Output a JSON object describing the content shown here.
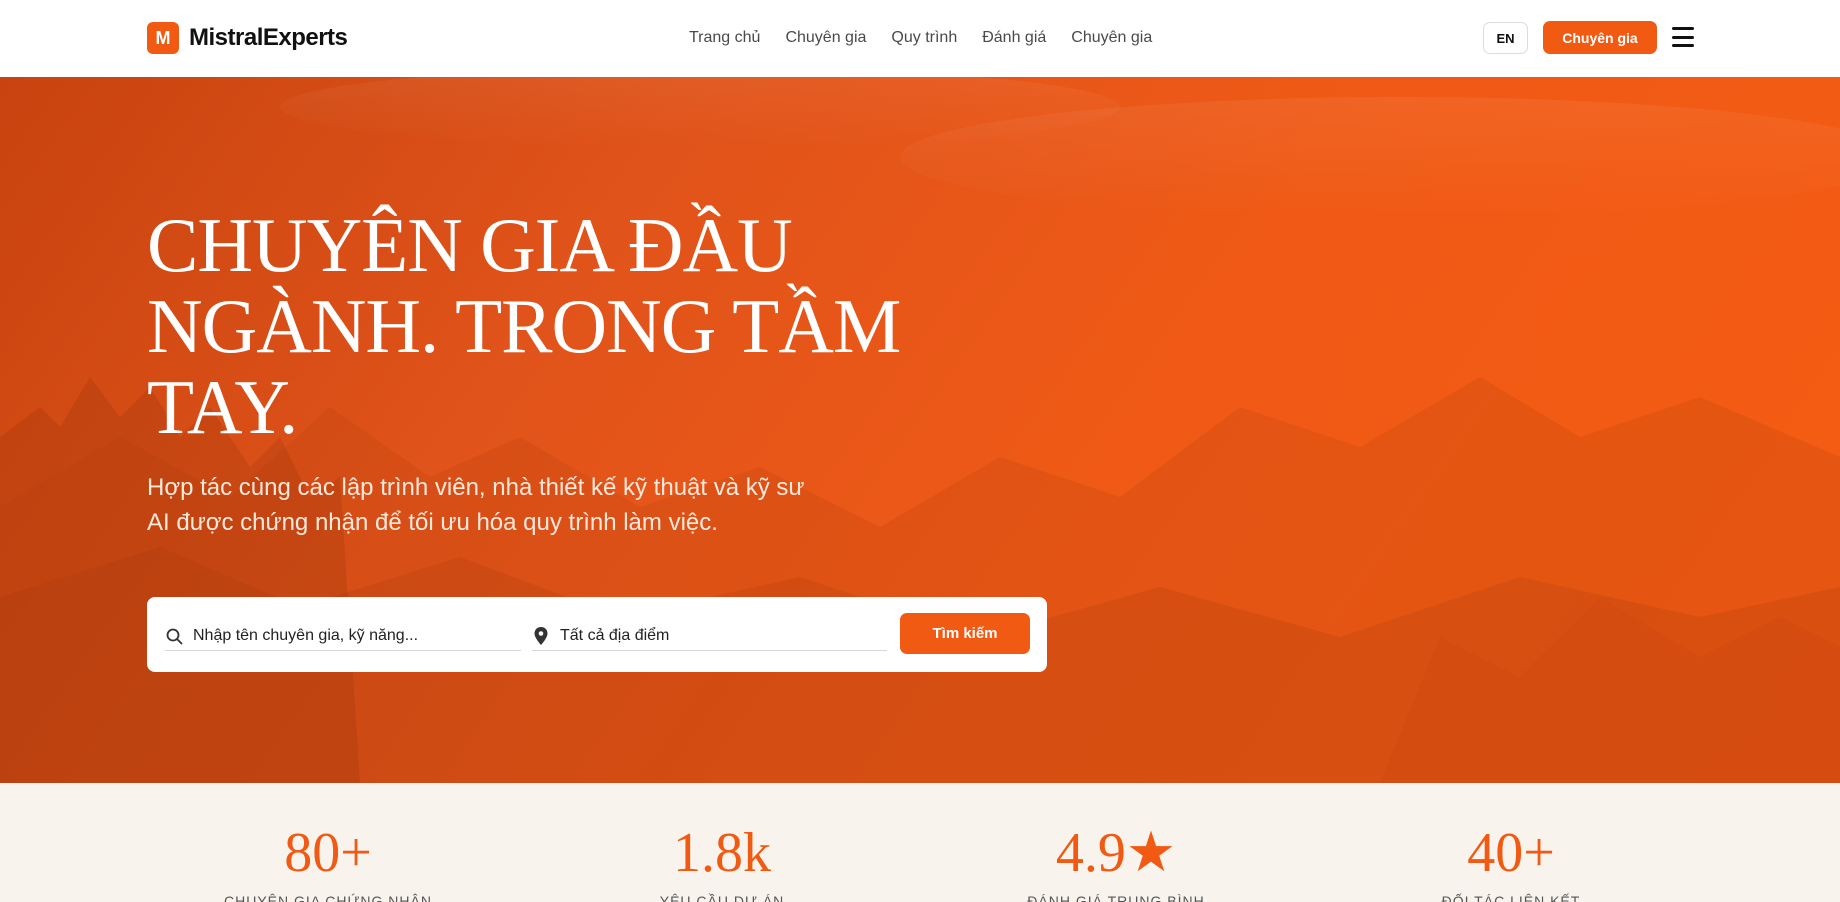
{
  "brand": {
    "logo_letter": "M",
    "name": "MistralExperts",
    "accent": "#f05a12"
  },
  "nav": {
    "items": [
      {
        "label": "Trang chủ"
      },
      {
        "label": "Chuyên gia"
      },
      {
        "label": "Quy trình"
      },
      {
        "label": "Đánh giá"
      },
      {
        "label": "Chuyên gia"
      }
    ]
  },
  "header": {
    "lang_label": "EN",
    "cta_label": "Chuyên gia",
    "menu_icon": "hamburger-menu-icon"
  },
  "hero": {
    "title": "CHUYÊN GIA ĐẦU NGÀNH. TRONG TẦM TAY.",
    "subtitle": "Hợp tác cùng các lập trình viên, nhà thiết kế kỹ thuật và kỹ sư AI được chứng nhận để tối ưu hóa quy trình làm việc."
  },
  "search": {
    "keyword_placeholder": "Nhập tên chuyên gia, kỹ năng...",
    "location_placeholder": "Tất cả địa điểm",
    "button_label": "Tìm kiếm",
    "keyword_icon": "search-icon",
    "location_icon": "location-pin-icon"
  },
  "stats": [
    {
      "value": "80+",
      "label": "Chuyên gia chứng nhận"
    },
    {
      "value": "1.8k",
      "label": "Yêu cầu dự án"
    },
    {
      "value": "4.9★",
      "label": "Đánh giá trung bình"
    },
    {
      "value": "40+",
      "label": "Đối tác liên kết"
    }
  ]
}
